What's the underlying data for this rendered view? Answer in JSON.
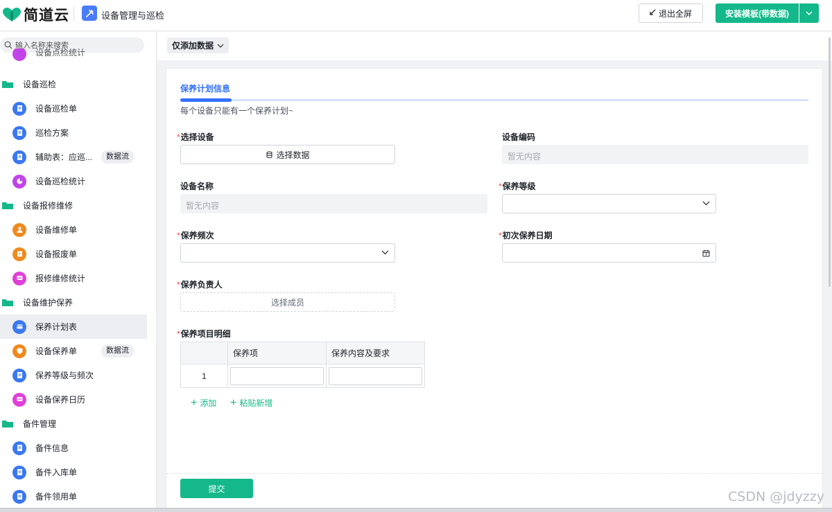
{
  "header": {
    "brand": "简道云",
    "app_title": "设备管理与巡检",
    "exit_fullscreen": "退出全屏",
    "install_template": "安装模板(带数据)",
    "brand_color": "#14b88a"
  },
  "sidebar": {
    "search_placeholder": "输入名称来搜索",
    "partial_item": "设备点检统计",
    "groups": [
      {
        "label": "设备巡检"
      },
      {
        "label": "设备报修维修"
      },
      {
        "label": "设备维护保养"
      },
      {
        "label": "备件管理"
      }
    ],
    "items": [
      {
        "label": "设备巡检单"
      },
      {
        "label": "巡检方案"
      },
      {
        "label": "辅助表：应巡...",
        "tag": "数据流"
      },
      {
        "label": "设备巡检统计"
      },
      {
        "label": "设备维修单"
      },
      {
        "label": "设备报废单"
      },
      {
        "label": "报修维修统计"
      },
      {
        "label": "保养计划表"
      },
      {
        "label": "设备保养单",
        "tag": "数据流"
      },
      {
        "label": "保养等级与频次"
      },
      {
        "label": "设备保养日历"
      },
      {
        "label": "备件信息"
      },
      {
        "label": "备件入库单"
      },
      {
        "label": "备件领用单"
      }
    ]
  },
  "toolbar": {
    "filter_label": "仅添加数据"
  },
  "form": {
    "section_title": "保养计划信息",
    "section_desc": "每个设备只能有一个保养计划~",
    "fields": {
      "device": {
        "label": "选择设备",
        "button": "选择数据"
      },
      "device_code": {
        "label": "设备编码",
        "placeholder": "暂无内容"
      },
      "device_name": {
        "label": "设备名称",
        "placeholder": "暂无内容"
      },
      "level": {
        "label": "保养等级"
      },
      "frequency": {
        "label": "保养频次"
      },
      "first_date": {
        "label": "初次保养日期"
      },
      "owner": {
        "label": "保养负责人",
        "placeholder": "选择成员"
      },
      "details": {
        "label": "保养项目明细"
      }
    },
    "table": {
      "headers": [
        "",
        "保养项",
        "保养内容及要求"
      ],
      "rows": [
        {
          "index": "1"
        }
      ]
    },
    "add_label": "添加",
    "paste_label": "粘贴新增",
    "submit_label": "提交"
  },
  "watermark": "CSDN @jdyzzy"
}
